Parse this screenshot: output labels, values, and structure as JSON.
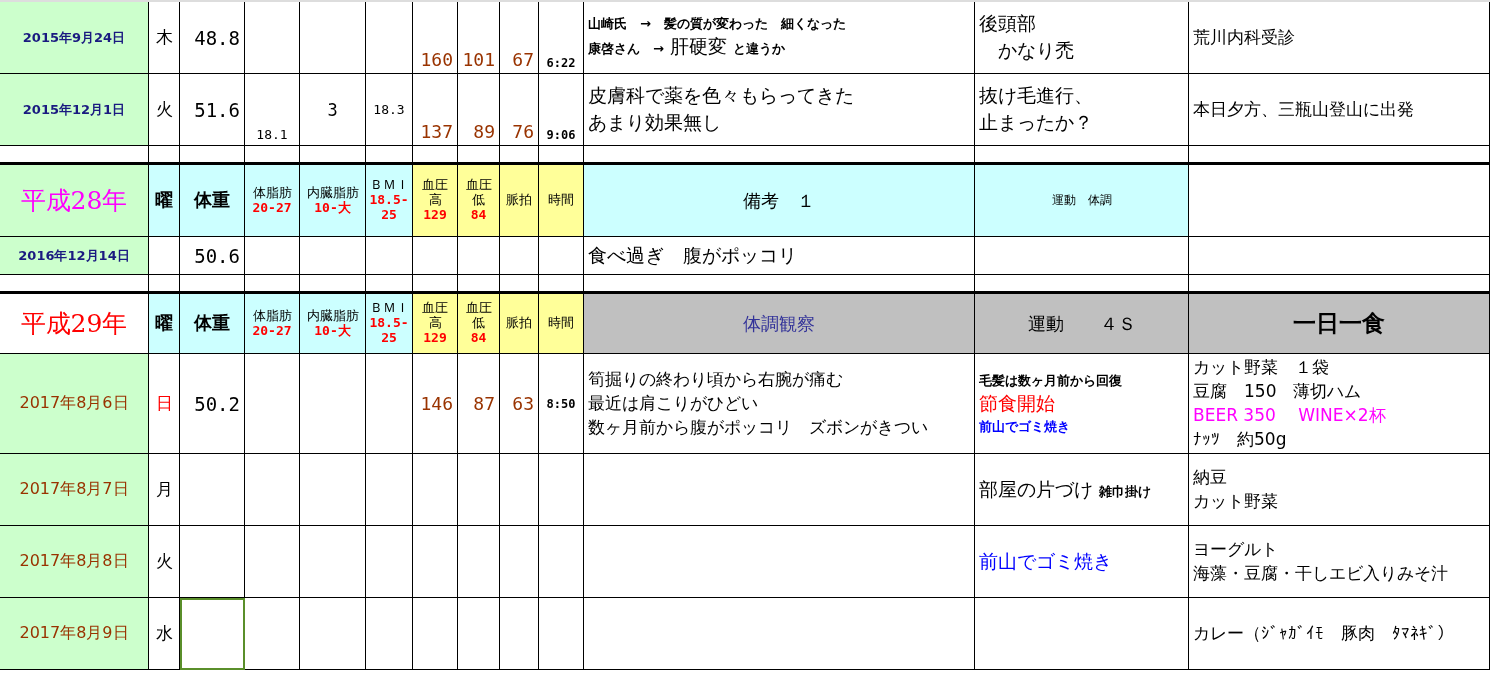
{
  "blocks": [
    {
      "kind": "entries",
      "rows": [
        {
          "date": {
            "text": "2015年9月24日",
            "color": "#1a1a80",
            "bold": true
          },
          "day": {
            "text": "木",
            "color": "#000000"
          },
          "weight": "48.8",
          "bp_high": "160",
          "bp_low": "101",
          "pulse": "67",
          "time": "6:22",
          "readings_at_bottom": true,
          "weight_cell_selected": false,
          "notes": [
            {
              "parts": [
                {
                  "text": "山崎氏　→　髪の質が変わった　細くなった",
                  "kind": "small",
                  "color": "#000000"
                }
              ]
            },
            {
              "parts": [
                {
                  "text": "康啓さん　→",
                  "kind": "small",
                  "color": "#000000"
                },
                {
                  "text": "肝硬変",
                  "kind": "large",
                  "color": "#000000"
                },
                {
                  "text": "と違うか",
                  "kind": "small",
                  "color": "#000000"
                }
              ]
            }
          ],
          "exercise": [
            {
              "parts": [
                {
                  "text": "後頭部",
                  "kind": "large",
                  "color": "#000000"
                }
              ]
            },
            {
              "parts": [
                {
                  "text": "　かなり禿",
                  "kind": "large",
                  "color": "#000000"
                }
              ]
            }
          ],
          "meal": [
            {
              "parts": [
                {
                  "text": "荒川内科受診",
                  "kind": "medium",
                  "color": "#000000"
                }
              ]
            }
          ]
        },
        {
          "date": {
            "text": "2015年12月1日",
            "color": "#1a1a80",
            "bold": true
          },
          "day": {
            "text": "火",
            "color": "#000000"
          },
          "weight": "51.6",
          "fat": "18.1",
          "visceral": "3",
          "bmi": "18.3",
          "bp_high": "137",
          "bp_low": "89",
          "pulse": "76",
          "time": "9:06",
          "readings_at_bottom": true,
          "weight_cell_selected": false,
          "notes": [
            {
              "parts": [
                {
                  "text": "皮膚科で薬を色々もらってきた",
                  "kind": "large",
                  "color": "#000000"
                }
              ]
            },
            {
              "parts": [
                {
                  "text": "あまり効果無し",
                  "kind": "large",
                  "color": "#000000"
                }
              ]
            }
          ],
          "exercise": [
            {
              "parts": [
                {
                  "text": "抜け毛進行、",
                  "kind": "large",
                  "color": "#000000"
                }
              ]
            },
            {
              "parts": [
                {
                  "text": "止まったか？",
                  "kind": "large",
                  "color": "#000000"
                }
              ]
            }
          ],
          "meal": [
            {
              "parts": [
                {
                  "text": "本日夕方、三瓶山登山に出発",
                  "kind": "medium",
                  "color": "#000000"
                }
              ]
            }
          ]
        }
      ]
    },
    {
      "kind": "spacer"
    },
    {
      "kind": "header",
      "shaded": false,
      "year": "平成28年",
      "color": "#ff00ff",
      "columns": [
        {
          "lines": [
            "曜"
          ],
          "color": "#ccffff"
        },
        {
          "lines": [
            "体重"
          ],
          "color": "#ccffff"
        },
        {
          "lines": [
            "体脂肪"
          ],
          "range": [
            "20-27"
          ],
          "color": "#ccffff"
        },
        {
          "lines": [
            "内臓脂肪"
          ],
          "range": [
            "10-大"
          ],
          "color": "#ccffff"
        },
        {
          "lines": [
            "ＢＭＩ"
          ],
          "range": [
            "18.5-",
            "25"
          ],
          "color": "#ccffff"
        },
        {
          "lines": [
            "血圧",
            "高"
          ],
          "range": [
            "129"
          ],
          "color": "#ffff99"
        },
        {
          "lines": [
            "血圧",
            "低"
          ],
          "range": [
            "84"
          ],
          "color": "#ffff99"
        },
        {
          "lines": [
            "脈拍"
          ],
          "color": "#ffff99"
        },
        {
          "lines": [
            "時間"
          ],
          "color": "#ffff99"
        }
      ],
      "remarks": [
        {
          "text": "備考　１",
          "kind": "medium",
          "color": "#000000"
        },
        {
          "text": "運動　体調",
          "kind": "small",
          "color": "#000000"
        }
      ]
    },
    {
      "kind": "entries",
      "rows": [
        {
          "date": {
            "text": "2016年12月14日",
            "color": "#1a1a80",
            "bold": true
          },
          "weight": "50.6",
          "weight_cell_selected": false,
          "notes": [
            {
              "parts": [
                {
                  "text": "食べ過ぎ　腹がポッコリ",
                  "kind": "large",
                  "color": "#000000"
                }
              ]
            }
          ]
        }
      ]
    },
    {
      "kind": "spacer"
    },
    {
      "kind": "header",
      "shaded": true,
      "year": "平成29年",
      "color": "#ff0000",
      "columns": [
        {
          "lines": [
            "曜"
          ],
          "color": "#ccffff"
        },
        {
          "lines": [
            "体重"
          ],
          "color": "#ccffff"
        },
        {
          "lines": [
            "体脂肪"
          ],
          "range": [
            "20-27"
          ],
          "color": "#ccffff"
        },
        {
          "lines": [
            "内臓脂肪"
          ],
          "range": [
            "10-大"
          ],
          "color": "#ccffff"
        },
        {
          "lines": [
            "ＢＭＩ"
          ],
          "range": [
            "18.5-",
            "25"
          ],
          "color": "#ccffff"
        },
        {
          "lines": [
            "血圧",
            "高"
          ],
          "range": [
            "129"
          ],
          "color": "#ffff99"
        },
        {
          "lines": [
            "血圧",
            "低"
          ],
          "range": [
            "84"
          ],
          "color": "#ffff99"
        },
        {
          "lines": [
            "脈拍"
          ],
          "color": "#ffff99"
        },
        {
          "lines": [
            "時間"
          ],
          "color": "#ffff99"
        }
      ],
      "remarks": [
        {
          "text": "体調観察",
          "kind": "medium",
          "color": "#333399"
        },
        {
          "text": "運動　　４Ｓ",
          "kind": "medium",
          "color": "#000000"
        },
        {
          "text": "一日一食",
          "kind": "large",
          "color": "#000000"
        }
      ]
    },
    {
      "kind": "entries",
      "rows": [
        {
          "date": {
            "text": "2017年8月6日",
            "color": "#993300",
            "bold": false
          },
          "day": {
            "text": "日",
            "color": "#ff0000"
          },
          "weight": "50.2",
          "bp_high": "146",
          "bp_low": "87",
          "pulse": "63",
          "time": "8:50",
          "readings_at_bottom": false,
          "weight_cell_selected": false,
          "notes": [
            {
              "parts": [
                {
                  "text": "筍掘りの終わり頃から右腕が痛む",
                  "kind": "medium",
                  "color": "#000000"
                }
              ]
            },
            {
              "parts": [
                {
                  "text": "最近は肩こりがひどい",
                  "kind": "medium",
                  "color": "#000000"
                }
              ]
            },
            {
              "parts": [
                {
                  "text": "数ヶ月前から腹がポッコリ　ズボンがきつい",
                  "kind": "medium",
                  "color": "#000000"
                }
              ]
            }
          ],
          "exercise": [
            {
              "parts": [
                {
                  "text": "毛髪は数ヶ月前から回復",
                  "kind": "small",
                  "color": "#000000"
                }
              ]
            },
            {
              "parts": [
                {
                  "text": "節食開始",
                  "kind": "large",
                  "color": "#ff0000"
                }
              ]
            },
            {
              "parts": [
                {
                  "text": "前山でゴミ焼き",
                  "kind": "small",
                  "color": "#0000ff"
                }
              ]
            }
          ],
          "meal": [
            {
              "parts": [
                {
                  "text": "カット野菜　１袋",
                  "kind": "medium",
                  "color": "#000000"
                }
              ]
            },
            {
              "parts": [
                {
                  "text": "豆腐　150　薄切ハム",
                  "kind": "medium",
                  "color": "#000000"
                }
              ]
            },
            {
              "parts": [
                {
                  "text": "BEER 350　 WINE×2杯",
                  "kind": "medium",
                  "color": "#ff00ff"
                }
              ]
            },
            {
              "parts": [
                {
                  "text": "ﾅｯﾂ　約50g",
                  "kind": "medium",
                  "color": "#000000"
                }
              ]
            }
          ]
        },
        {
          "date": {
            "text": "2017年8月7日",
            "color": "#993300",
            "bold": false
          },
          "day": {
            "text": "月",
            "color": "#000000"
          },
          "weight_cell_selected": false,
          "exercise": [
            {
              "parts": [
                {
                  "text": "部屋の片づけ",
                  "kind": "large",
                  "color": "#000000"
                },
                {
                  "text": "雑巾掛け",
                  "kind": "small",
                  "color": "#000000"
                }
              ]
            }
          ],
          "meal": [
            {
              "parts": [
                {
                  "text": "納豆",
                  "kind": "medium",
                  "color": "#000000"
                }
              ]
            },
            {
              "parts": [
                {
                  "text": "カット野菜",
                  "kind": "medium",
                  "color": "#000000"
                }
              ]
            }
          ]
        },
        {
          "date": {
            "text": "2017年8月8日",
            "color": "#993300",
            "bold": false
          },
          "day": {
            "text": "火",
            "color": "#000000"
          },
          "weight_cell_selected": false,
          "exercise": [
            {
              "parts": [
                {
                  "text": "前山でゴミ焼き",
                  "kind": "large",
                  "color": "#0000ff"
                }
              ]
            }
          ],
          "meal": [
            {
              "parts": [
                {
                  "text": "ヨーグルト",
                  "kind": "medium",
                  "color": "#000000"
                }
              ]
            },
            {
              "parts": [
                {
                  "text": "海藻・豆腐・干しエビ入りみそ汁",
                  "kind": "medium",
                  "color": "#000000"
                }
              ]
            }
          ]
        },
        {
          "date": {
            "text": "2017年8月9日",
            "color": "#993300",
            "bold": false
          },
          "day": {
            "text": "水",
            "color": "#000000"
          },
          "weight_cell_selected": true,
          "meal": [
            {
              "parts": [
                {
                  "text": "カレー（ｼﾞｬｶﾞｲﾓ　豚肉　ﾀﾏﾈｷﾞ）",
                  "kind": "medium",
                  "color": "#000000"
                }
              ]
            }
          ]
        }
      ]
    }
  ]
}
